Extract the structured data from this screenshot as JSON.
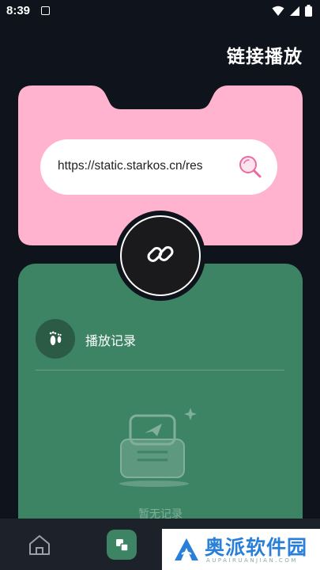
{
  "status_bar": {
    "time": "8:39"
  },
  "header": {
    "title": "链接播放"
  },
  "url_input": {
    "value": "https://static.starkos.cn/res"
  },
  "history": {
    "label": "播放记录",
    "empty_text": "暂无记录"
  },
  "watermark": {
    "name": "奥派软件园",
    "domain": "AUPAIRUANJIAN.COM"
  },
  "colors": {
    "background": "#0f131b",
    "pink_card": "#ffb3ce",
    "green_card": "#3c8464",
    "nav_bar": "#1d212a",
    "accent": "#3c8464"
  },
  "icons": [
    "notification-icon",
    "wifi-icon",
    "signal-icon",
    "battery-icon",
    "search-icon",
    "link-icon",
    "footprint-icon",
    "empty-box-icon",
    "home-icon",
    "apps-icon"
  ]
}
